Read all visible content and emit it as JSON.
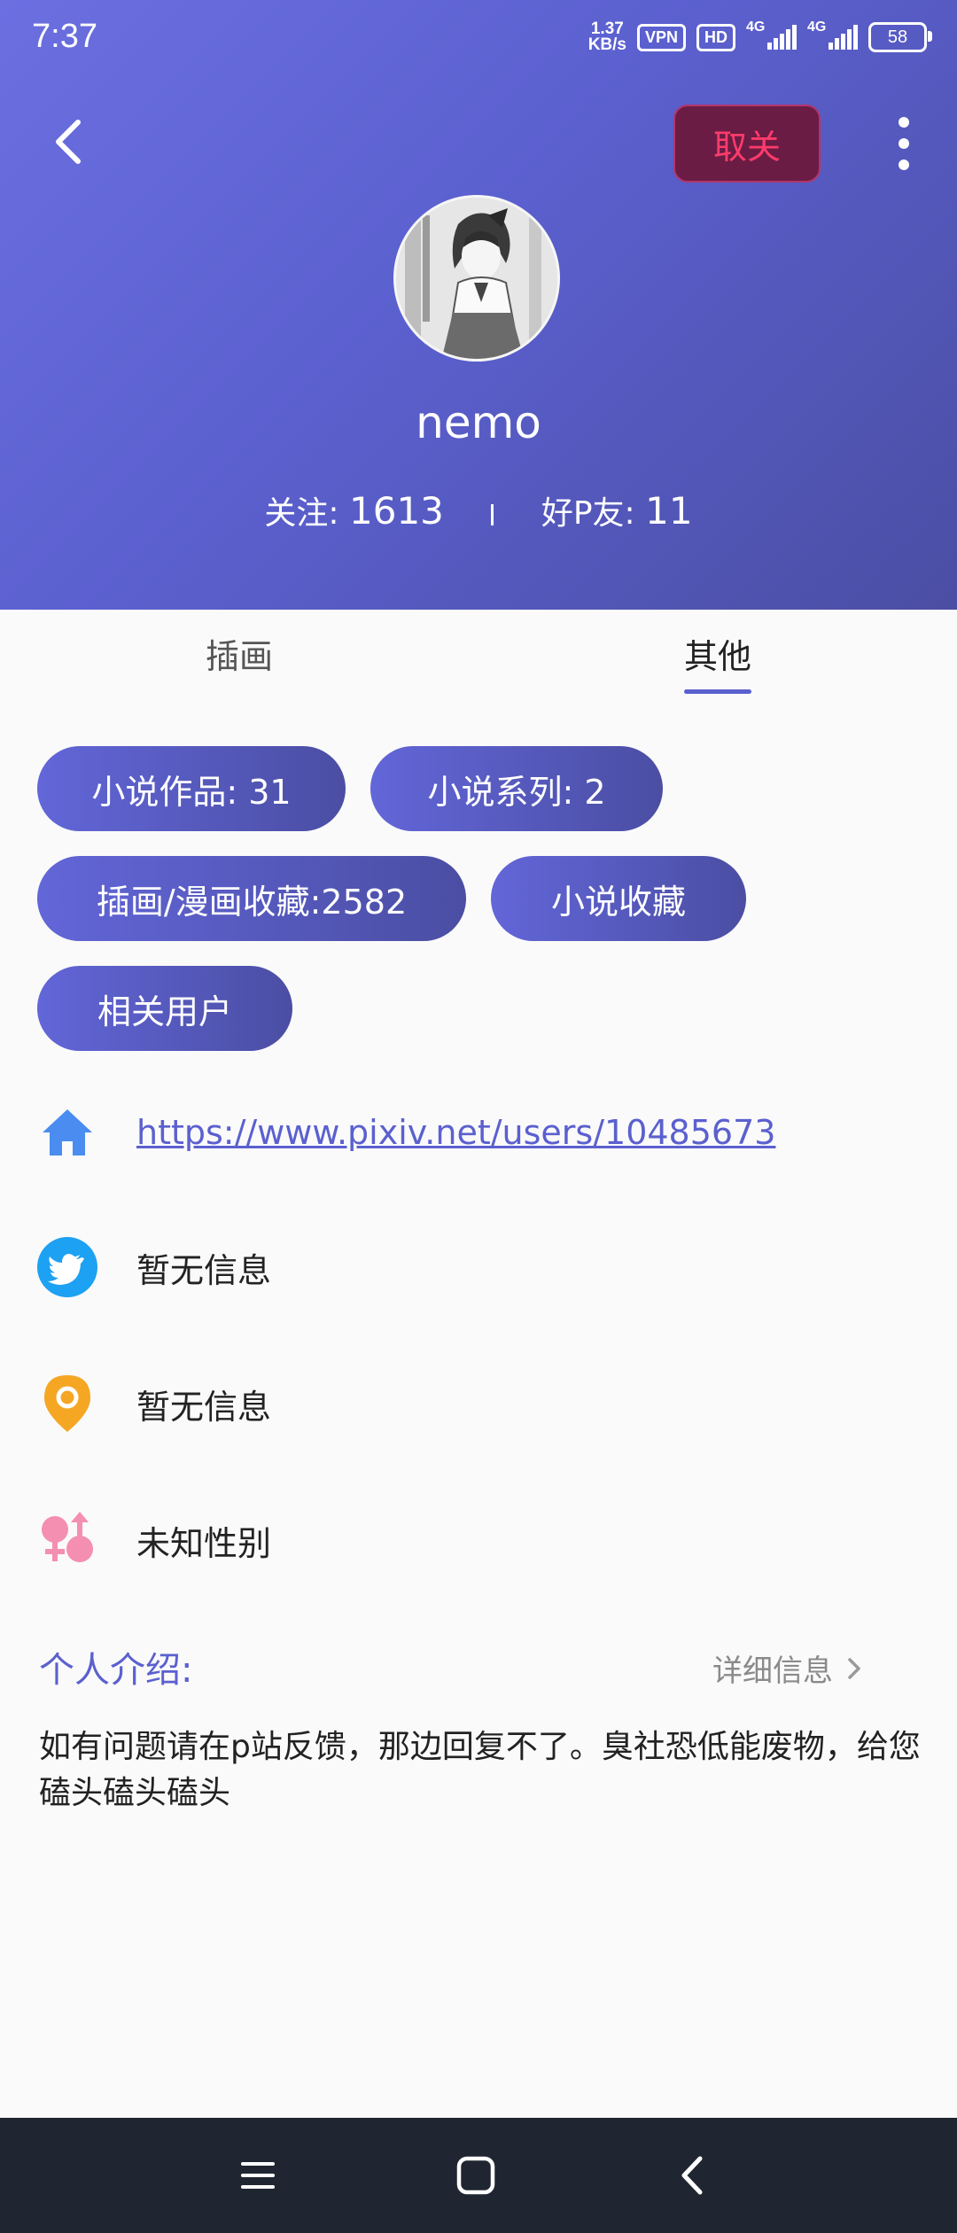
{
  "status_bar": {
    "time": "7:37",
    "net_speed_value": "1.37",
    "net_speed_unit": "KB/s",
    "vpn": "VPN",
    "hd": "HD",
    "network1": "4G",
    "network2": "4G",
    "battery": "58"
  },
  "header": {
    "unfollow_label": "取关",
    "username": "nemo",
    "following_label": "关注:",
    "following_count": "1613",
    "friends_label": "好P友:",
    "friends_count": "11"
  },
  "tabs": [
    {
      "label": "插画"
    },
    {
      "label": "其他",
      "active": true
    }
  ],
  "chips": [
    {
      "label": "小说作品: 31"
    },
    {
      "label": "小说系列: 2"
    },
    {
      "label": "插画/漫画收藏:2582"
    },
    {
      "label": "小说收藏"
    },
    {
      "label": "相关用户"
    }
  ],
  "info": {
    "homepage": "https://www.pixiv.net/users/10485673",
    "twitter": "暂无信息",
    "location": "暂无信息",
    "gender": "未知性别"
  },
  "intro": {
    "title": "个人介绍:",
    "detail_link": "详细信息",
    "text": "如有问题请在p站反馈，那边回复不了。臭社恐低能废物，给您磕头磕头磕头"
  },
  "colors": {
    "accent": "#5b60cf",
    "header_start": "#6b6fe0",
    "header_end": "#4b4ea3",
    "unfollow_bg": "#6a1c44",
    "unfollow_text": "#ff3b6b",
    "home_icon": "#4a8cf0",
    "twitter_icon": "#1da1f2",
    "location_icon": "#f5a623",
    "gender_icon": "#f48fb1",
    "nav_bar": "#202631"
  },
  "icons": [
    "back-arrow-icon",
    "more-vertical-icon",
    "home-icon",
    "twitter-icon",
    "location-pin-icon",
    "gender-icon",
    "chevron-right-icon",
    "menu-icon",
    "square-home-icon",
    "nav-back-icon"
  ]
}
